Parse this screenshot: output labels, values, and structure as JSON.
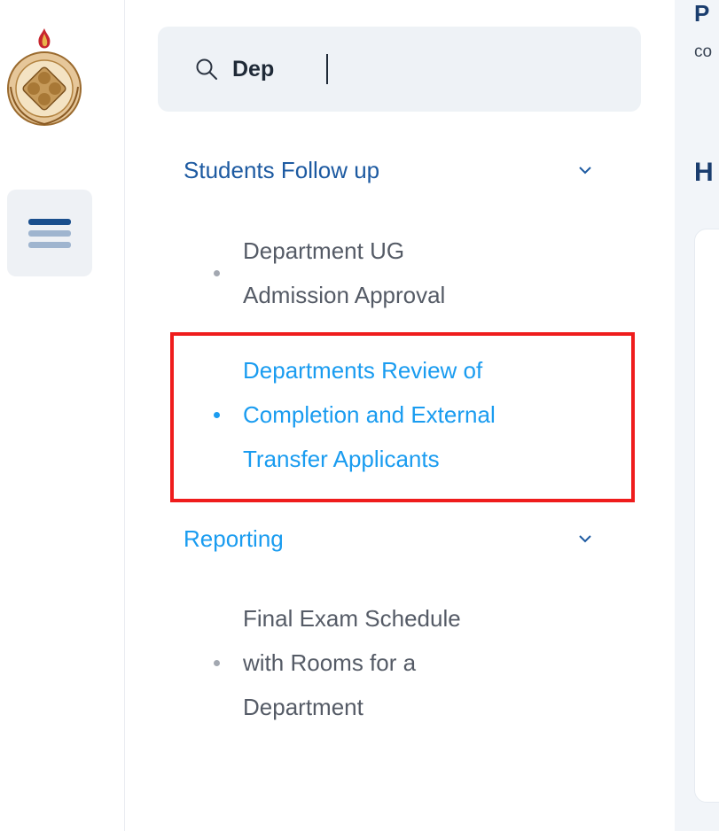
{
  "colors": {
    "accent": "#1a9cf0",
    "group_text": "#1d5aa1",
    "item_text": "#555b66",
    "highlight_box": "#ef1c1c"
  },
  "rail": {
    "logo_name": "university-logo",
    "menu_icon": "hamburger-menu-icon"
  },
  "search": {
    "value": "Dep",
    "icon": "search-icon"
  },
  "nav": {
    "groups": [
      {
        "label": "Students Follow up",
        "icon": "chevron-down-icon",
        "items": [
          {
            "lines": [
              "Department UG",
              "Admission Approval"
            ],
            "active": false
          },
          {
            "lines": [
              "Departments Review of",
              "Completion and External",
              "Transfer Applicants"
            ],
            "active": true
          }
        ]
      },
      {
        "label": "Reporting",
        "icon": "chevron-down-icon",
        "items": [
          {
            "lines": [
              "Final Exam Schedule",
              "with Rooms for a",
              "Department"
            ],
            "active": false
          }
        ]
      }
    ]
  },
  "right": {
    "title_fragment": "P",
    "subtitle_fragment": "co",
    "heading_fragment": "H"
  }
}
